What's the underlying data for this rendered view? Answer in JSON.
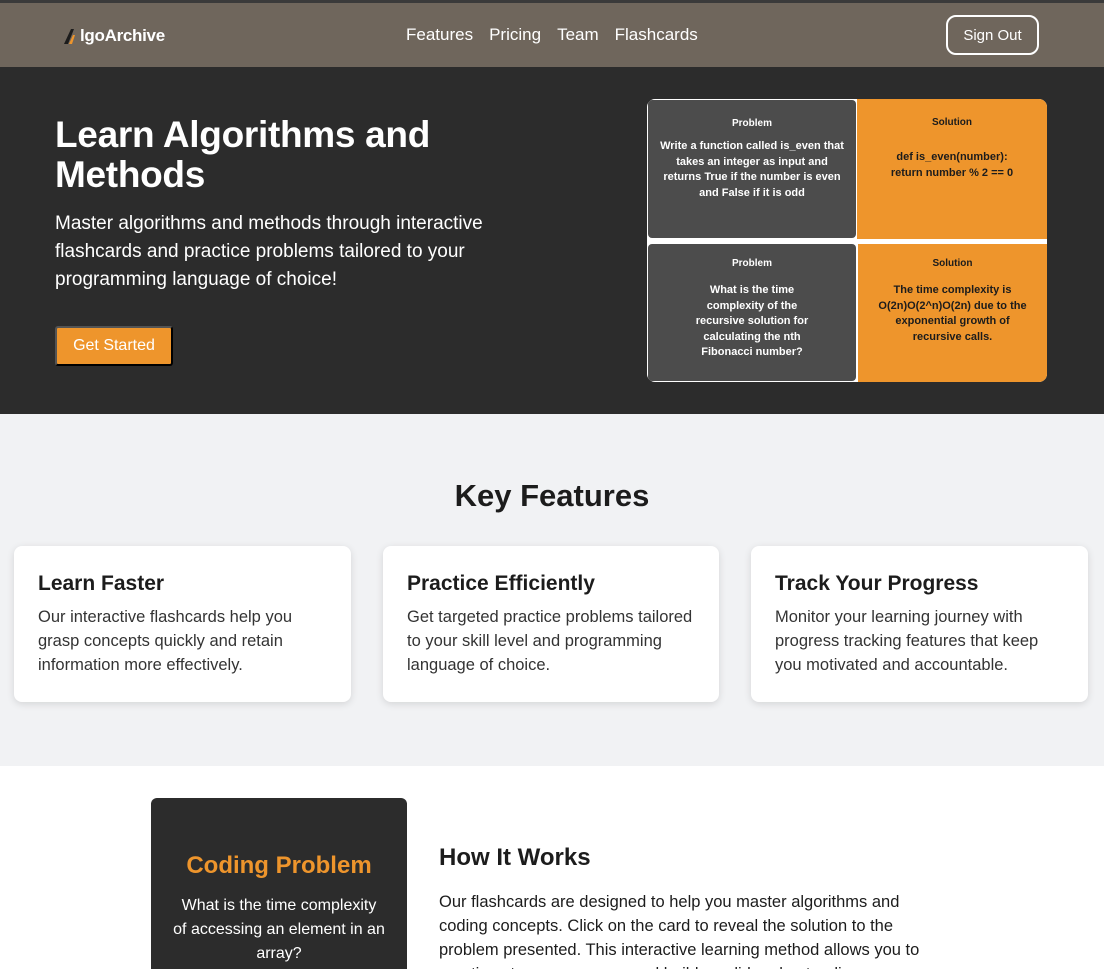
{
  "nav": {
    "logo_text": "lgoArchive",
    "links": [
      "Features",
      "Pricing",
      "Team",
      "Flashcards"
    ],
    "signout_label": "Sign Out"
  },
  "hero": {
    "title": "Learn Algorithms and Methods",
    "subtitle": "Master algorithms and methods through interactive flashcards and practice problems tailored to your programming language of choice!",
    "cta_label": "Get Started",
    "cards": [
      {
        "label": "Problem",
        "text": "Write a function called is_even that takes an integer as input and returns True if the number is even and False if it is odd"
      },
      {
        "label": "Solution",
        "text": "def is_even(number): return number % 2 == 0"
      },
      {
        "label": "Problem",
        "text": "What is the time complexity of the recursive solution for calculating the nth Fibonacci number?"
      },
      {
        "label": "Solution",
        "text": "The time complexity is O(2n)O(2^n)O(2n) due to the exponential growth of recursive calls."
      }
    ]
  },
  "features": {
    "title": "Key Features",
    "cards": [
      {
        "title": "Learn Faster",
        "text": "Our interactive flashcards help you grasp concepts quickly and retain information more effectively."
      },
      {
        "title": "Practice Efficiently",
        "text": "Get targeted practice problems tailored to your skill level and programming language of choice."
      },
      {
        "title": "Track Your Progress",
        "text": "Monitor your learning journey with progress tracking features that keep you motivated and accountable."
      }
    ]
  },
  "how": {
    "card_title": "Coding Problem",
    "card_text": "What is the time complexity of accessing an element in an array?",
    "title": "How It Works",
    "text": "Our flashcards are designed to help you master algorithms and coding concepts. Click on the card to reveal the solution to the problem presented. This interactive learning method allows you to practice at your own pace and build a solid understanding."
  },
  "colors": {
    "accent": "#ee952c",
    "nav_bg": "#6f665c",
    "hero_bg": "#2c2c2c",
    "problem_card_bg": "#4c4c4c",
    "page_bg": "#f1f2f4"
  },
  "icons": {
    "logo": "logo-a-icon"
  }
}
